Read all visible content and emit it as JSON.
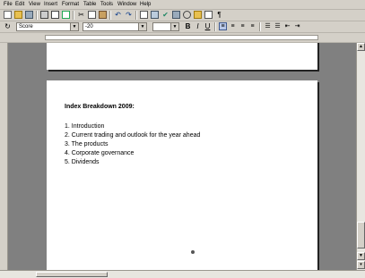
{
  "menu": {
    "items": [
      "File",
      "Edit",
      "View",
      "Insert",
      "Format",
      "Table",
      "Tools",
      "Window",
      "Help"
    ]
  },
  "format_bar": {
    "style_value": "Score",
    "font_value": "-20",
    "size_value": ""
  },
  "document": {
    "heading": "Index Breakdown 2009:",
    "toc": [
      "1. Introduction",
      "2. Current trading and outlook for the year ahead",
      "3. The products",
      "4. Corporate governance",
      "5. Dividends"
    ]
  },
  "icons": {
    "new": "new-document-icon",
    "open": "open-folder-icon",
    "save": "save-icon",
    "print": "print-icon",
    "preview": "print-preview-icon",
    "spell": "spellcheck-icon",
    "cut": "cut-icon",
    "copy": "copy-icon",
    "paste": "paste-icon",
    "undo": "undo-icon",
    "redo": "redo-icon"
  }
}
